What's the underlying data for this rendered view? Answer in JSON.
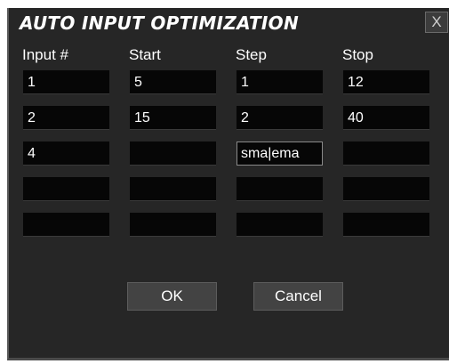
{
  "dialog": {
    "title": "AUTO INPUT OPTIMIZATION",
    "close_label": "X"
  },
  "columns": [
    "Input #",
    "Start",
    "Step",
    "Stop"
  ],
  "rows": [
    [
      "1",
      "5",
      "1",
      "12"
    ],
    [
      "2",
      "15",
      "2",
      "40"
    ],
    [
      "4",
      "",
      "sma|ema",
      ""
    ],
    [
      "",
      "",
      "",
      ""
    ],
    [
      "",
      "",
      "",
      ""
    ]
  ],
  "buttons": {
    "ok_label": "OK",
    "cancel_label": "Cancel"
  }
}
